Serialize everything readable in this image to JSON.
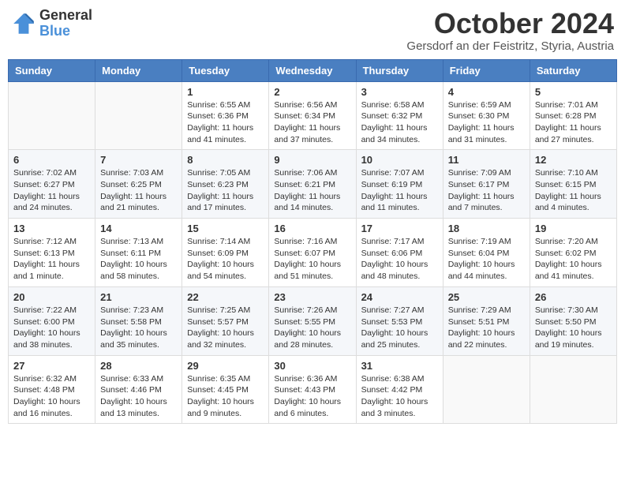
{
  "header": {
    "logo_general": "General",
    "logo_blue": "Blue",
    "month_title": "October 2024",
    "location": "Gersdorf an der Feistritz, Styria, Austria"
  },
  "weekdays": [
    "Sunday",
    "Monday",
    "Tuesday",
    "Wednesday",
    "Thursday",
    "Friday",
    "Saturday"
  ],
  "weeks": [
    [
      {
        "day": "",
        "info": ""
      },
      {
        "day": "",
        "info": ""
      },
      {
        "day": "1",
        "info": "Sunrise: 6:55 AM\nSunset: 6:36 PM\nDaylight: 11 hours and 41 minutes."
      },
      {
        "day": "2",
        "info": "Sunrise: 6:56 AM\nSunset: 6:34 PM\nDaylight: 11 hours and 37 minutes."
      },
      {
        "day": "3",
        "info": "Sunrise: 6:58 AM\nSunset: 6:32 PM\nDaylight: 11 hours and 34 minutes."
      },
      {
        "day": "4",
        "info": "Sunrise: 6:59 AM\nSunset: 6:30 PM\nDaylight: 11 hours and 31 minutes."
      },
      {
        "day": "5",
        "info": "Sunrise: 7:01 AM\nSunset: 6:28 PM\nDaylight: 11 hours and 27 minutes."
      }
    ],
    [
      {
        "day": "6",
        "info": "Sunrise: 7:02 AM\nSunset: 6:27 PM\nDaylight: 11 hours and 24 minutes."
      },
      {
        "day": "7",
        "info": "Sunrise: 7:03 AM\nSunset: 6:25 PM\nDaylight: 11 hours and 21 minutes."
      },
      {
        "day": "8",
        "info": "Sunrise: 7:05 AM\nSunset: 6:23 PM\nDaylight: 11 hours and 17 minutes."
      },
      {
        "day": "9",
        "info": "Sunrise: 7:06 AM\nSunset: 6:21 PM\nDaylight: 11 hours and 14 minutes."
      },
      {
        "day": "10",
        "info": "Sunrise: 7:07 AM\nSunset: 6:19 PM\nDaylight: 11 hours and 11 minutes."
      },
      {
        "day": "11",
        "info": "Sunrise: 7:09 AM\nSunset: 6:17 PM\nDaylight: 11 hours and 7 minutes."
      },
      {
        "day": "12",
        "info": "Sunrise: 7:10 AM\nSunset: 6:15 PM\nDaylight: 11 hours and 4 minutes."
      }
    ],
    [
      {
        "day": "13",
        "info": "Sunrise: 7:12 AM\nSunset: 6:13 PM\nDaylight: 11 hours and 1 minute."
      },
      {
        "day": "14",
        "info": "Sunrise: 7:13 AM\nSunset: 6:11 PM\nDaylight: 10 hours and 58 minutes."
      },
      {
        "day": "15",
        "info": "Sunrise: 7:14 AM\nSunset: 6:09 PM\nDaylight: 10 hours and 54 minutes."
      },
      {
        "day": "16",
        "info": "Sunrise: 7:16 AM\nSunset: 6:07 PM\nDaylight: 10 hours and 51 minutes."
      },
      {
        "day": "17",
        "info": "Sunrise: 7:17 AM\nSunset: 6:06 PM\nDaylight: 10 hours and 48 minutes."
      },
      {
        "day": "18",
        "info": "Sunrise: 7:19 AM\nSunset: 6:04 PM\nDaylight: 10 hours and 44 minutes."
      },
      {
        "day": "19",
        "info": "Sunrise: 7:20 AM\nSunset: 6:02 PM\nDaylight: 10 hours and 41 minutes."
      }
    ],
    [
      {
        "day": "20",
        "info": "Sunrise: 7:22 AM\nSunset: 6:00 PM\nDaylight: 10 hours and 38 minutes."
      },
      {
        "day": "21",
        "info": "Sunrise: 7:23 AM\nSunset: 5:58 PM\nDaylight: 10 hours and 35 minutes."
      },
      {
        "day": "22",
        "info": "Sunrise: 7:25 AM\nSunset: 5:57 PM\nDaylight: 10 hours and 32 minutes."
      },
      {
        "day": "23",
        "info": "Sunrise: 7:26 AM\nSunset: 5:55 PM\nDaylight: 10 hours and 28 minutes."
      },
      {
        "day": "24",
        "info": "Sunrise: 7:27 AM\nSunset: 5:53 PM\nDaylight: 10 hours and 25 minutes."
      },
      {
        "day": "25",
        "info": "Sunrise: 7:29 AM\nSunset: 5:51 PM\nDaylight: 10 hours and 22 minutes."
      },
      {
        "day": "26",
        "info": "Sunrise: 7:30 AM\nSunset: 5:50 PM\nDaylight: 10 hours and 19 minutes."
      }
    ],
    [
      {
        "day": "27",
        "info": "Sunrise: 6:32 AM\nSunset: 4:48 PM\nDaylight: 10 hours and 16 minutes."
      },
      {
        "day": "28",
        "info": "Sunrise: 6:33 AM\nSunset: 4:46 PM\nDaylight: 10 hours and 13 minutes."
      },
      {
        "day": "29",
        "info": "Sunrise: 6:35 AM\nSunset: 4:45 PM\nDaylight: 10 hours and 9 minutes."
      },
      {
        "day": "30",
        "info": "Sunrise: 6:36 AM\nSunset: 4:43 PM\nDaylight: 10 hours and 6 minutes."
      },
      {
        "day": "31",
        "info": "Sunrise: 6:38 AM\nSunset: 4:42 PM\nDaylight: 10 hours and 3 minutes."
      },
      {
        "day": "",
        "info": ""
      },
      {
        "day": "",
        "info": ""
      }
    ]
  ]
}
